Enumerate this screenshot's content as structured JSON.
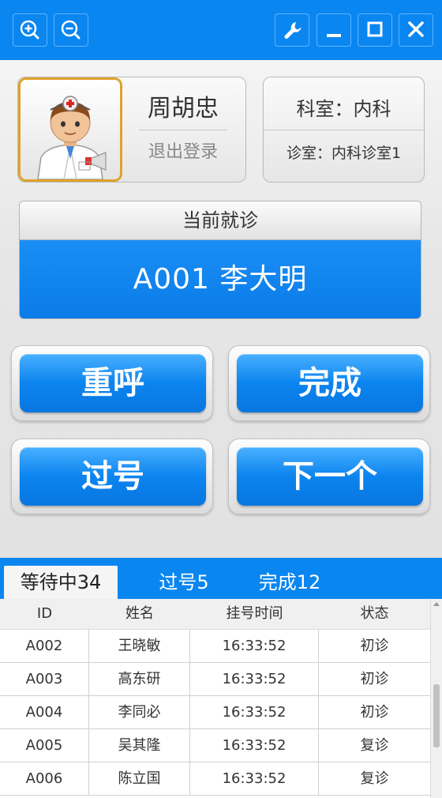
{
  "doctor": {
    "name": "周胡忠",
    "logout_label": "退出登录"
  },
  "department": {
    "dept_label": "科室：内科",
    "room_label": "诊室：内科诊室1"
  },
  "current": {
    "header": "当前就诊",
    "patient": "A001 李大明"
  },
  "actions": {
    "recall": "重呼",
    "complete": "完成",
    "skip": "过号",
    "next": "下一个"
  },
  "tabs": [
    {
      "label": "等待中34"
    },
    {
      "label": "过号5"
    },
    {
      "label": "完成12"
    }
  ],
  "table": {
    "columns": [
      "ID",
      "姓名",
      "挂号时间",
      "状态"
    ],
    "rows": [
      [
        "A002",
        "王晓敏",
        "16:33:52",
        "初诊"
      ],
      [
        "A003",
        "高东研",
        "16:33:52",
        "初诊"
      ],
      [
        "A004",
        "李同必",
        "16:33:52",
        "初诊"
      ],
      [
        "A005",
        "吴其隆",
        "16:33:52",
        "复诊"
      ],
      [
        "A006",
        "陈立国",
        "16:33:52",
        "复诊"
      ]
    ]
  },
  "colors": {
    "accent": "#0a86f0",
    "avatar_border": "#e0a22b"
  },
  "icons": [
    "zoom-in-icon",
    "zoom-out-icon",
    "wrench-icon",
    "minimize-icon",
    "maximize-icon",
    "close-icon",
    "doctor-avatar-icon"
  ]
}
